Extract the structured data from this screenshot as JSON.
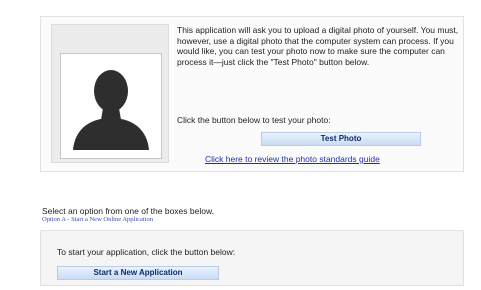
{
  "photo_section": {
    "intro": "This application will ask you to upload a digital photo of yourself. You must, however, use a digital photo that the computer system can process. If you would like, you can test your photo now to make sure the computer can process it—just click the \"Test Photo\" button below.",
    "test_prompt": "Click the button below to test your photo:",
    "test_button": "Test Photo",
    "guide_link": "Click here to review the photo standards guide",
    "placeholder_icon": "person-silhouette-icon"
  },
  "options": {
    "instruction": "Select an option from one of the boxes below.",
    "option_a_label": "Option A - Start a New Online Application",
    "start_prompt": "To start your application, click the button below:",
    "start_button": "Start a New Application"
  },
  "colors": {
    "link": "#1f2fa8",
    "button_text": "#0f2a6b",
    "button_fill": "#d6e6fa",
    "panel_bg": "#fbfbfb"
  }
}
